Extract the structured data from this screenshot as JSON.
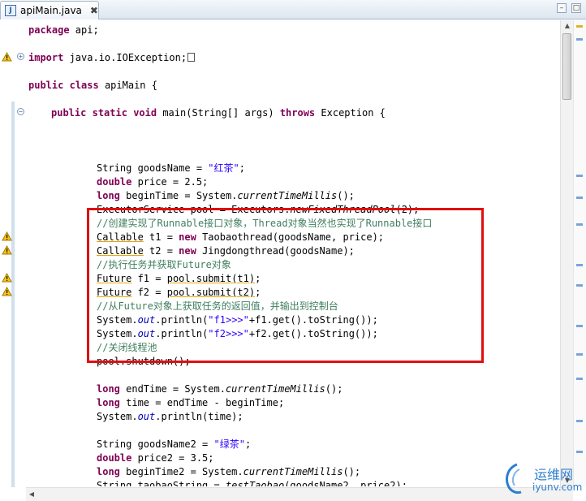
{
  "tab": {
    "icon_text": "J",
    "title": "apiMain.java",
    "close": "✖"
  },
  "window_buttons": {
    "minimize": "–",
    "maximize": "□"
  },
  "colors": {
    "keyword": "#7f0055",
    "string": "#2a00ff",
    "comment": "#3f7f5f",
    "highlight_box": "#e00f0f"
  },
  "code": {
    "l1": {
      "kw": "package",
      "rest": " api;"
    },
    "l2": {
      "kw": "import",
      "rest": " java.io.IOException;"
    },
    "l3": {
      "kw1": "public",
      "kw2": "class",
      "rest": " apiMain {"
    },
    "l4": {
      "kw1": "public",
      "kw2": "static",
      "kw3": "void",
      "mid": " main(String[] args) ",
      "kw4": "throws",
      "rest": " Exception {"
    },
    "l5": {
      "pre": "String goodsName = ",
      "str": "\"红茶\"",
      "post": ";"
    },
    "l6": {
      "kw": "double",
      "rest": " price = 2.5;"
    },
    "l7": {
      "kw": "long",
      "pre": " beginTime = System.",
      "it": "currentTimeMillis",
      "post": "();"
    },
    "l8": {
      "pre": "ExecutorService pool = Executors.",
      "it": "newFixedThreadPool",
      "post": "(2);"
    },
    "l9": {
      "cm": "//创建实现了Runnable接口对象，Thread对象当然也实现了Runnable接口"
    },
    "l10": {
      "ul": "Callable",
      "pre": " t1 = ",
      "kw": "new",
      "post": " Taobaothread(goodsName, price);"
    },
    "l11": {
      "ul": "Callable",
      "pre": " t2 = ",
      "kw": "new",
      "post": " Jingdongthread(goodsName);"
    },
    "l12": {
      "cm": "//执行任务并获取Future对象"
    },
    "l13": {
      "ul1": "Future",
      "pre": " f1 = ",
      "ul2": "pool.submit(t1)",
      "post": ";"
    },
    "l14": {
      "ul1": "Future",
      "pre": " f2 = ",
      "ul2": "pool.submit(t2)",
      "post": ";"
    },
    "l15": {
      "cm": "//从Future对象上获取任务的返回值，并输出到控制台"
    },
    "l16": {
      "pre": "System.",
      "fld": "out",
      "mid": ".println(",
      "str": "\"f1>>>\"",
      "post": "+f1.get().toString());"
    },
    "l17": {
      "pre": "System.",
      "fld": "out",
      "mid": ".println(",
      "str": "\"f2>>>\"",
      "post": "+f2.get().toString());"
    },
    "l18": {
      "cm": "//关闭线程池"
    },
    "l19": {
      "text": "pool.shutdown();"
    },
    "l20": {
      "kw": "long",
      "pre": " endTime = System.",
      "it": "currentTimeMillis",
      "post": "();"
    },
    "l21": {
      "kw": "long",
      "rest": " time = endTime - beginTime;"
    },
    "l22": {
      "pre": "System.",
      "fld": "out",
      "post": ".println(time);"
    },
    "l23": {
      "pre": "String goodsName2 = ",
      "str": "\"绿茶\"",
      "post": ";"
    },
    "l24": {
      "kw": "double",
      "rest": " price2 = 3.5;"
    },
    "l25": {
      "kw": "long",
      "pre": " beginTime2 = System.",
      "it": "currentTimeMillis",
      "post": "();"
    },
    "l26": {
      "pre": "String taobaoString = ",
      "it": "testTaobao",
      "post": "(goodsName2, price2);"
    }
  },
  "watermark": {
    "title": "运维网",
    "url": "iyunv.com"
  }
}
